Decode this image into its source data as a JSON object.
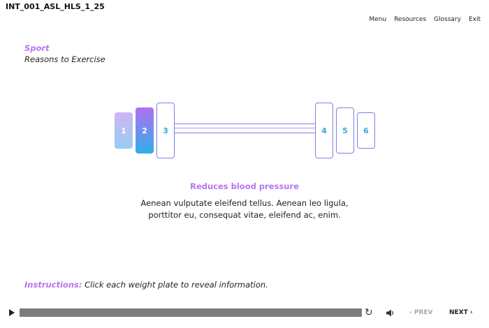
{
  "header": {
    "course_id": "INT_001_ASL_HLS_1_25"
  },
  "nav": {
    "menu": "Menu",
    "resources": "Resources",
    "glossary": "Glossary",
    "exit": "Exit"
  },
  "section": {
    "title": "Sport",
    "subtitle": "Reasons to Exercise"
  },
  "plates": [
    "1",
    "2",
    "3",
    "4",
    "5",
    "6"
  ],
  "info": {
    "title": "Reduces blood pressure",
    "body": "Aenean vulputate eleifend tellus. Aenean leo ligula, porttitor eu, consequat vitae, eleifend ac, enim."
  },
  "instructions": {
    "label": "Instructions:",
    "text": "Click each weight plate to reveal information."
  },
  "controls": {
    "prev": "‹ PREV",
    "next": "NEXT ›",
    "replay_symbol": "↻"
  },
  "colors": {
    "accent": "#b476f0",
    "plate_border": "#7f7fe6",
    "plate_text": "#3aa4e0",
    "progress": "#7c7c7c"
  },
  "icons": [
    "play-icon",
    "replay-icon",
    "volume-icon"
  ]
}
